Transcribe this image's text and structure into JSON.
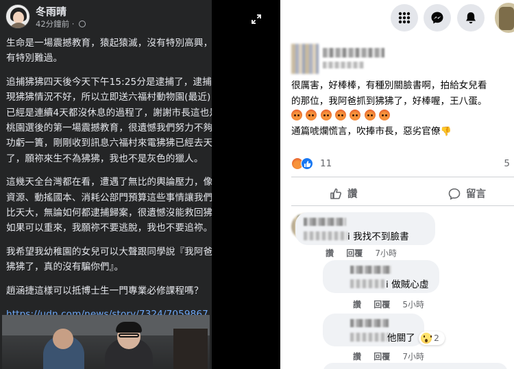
{
  "left_post": {
    "author": "冬雨晴",
    "time": "42分鐘前",
    "paragraphs": [
      [
        "生命是一場震撼教育，猿起猿滅，沒有特別高興，也沒",
        "有特別難過。"
      ],
      [
        "追捕狒狒四天後今天下午15:25分是逮捕了，逮捕後發",
        "現狒狒情況不好，所以立即送六福村動物園(最近)，這",
        "已經是連續4天都沒休息的過程了，謝謝市長這也是來",
        "桃園選後的第一場震撼教育，很遺憾我們努力不夠終究",
        "功虧一簣，剛剛收到訊息六福村來電狒狒已經去天堂",
        "了，願祢來生不為狒狒，我也不是灰色的獵人。"
      ],
      [
        "這幾天全台灣都在看，遭遇了無比的輿論壓力，像無限",
        "資源、動搖國本、消耗公部門預算這些事情讓我們壓力",
        "比天大，無論如何都逮捕歸案，很遺憾沒能救回狒狒！",
        "如果可以重來，我願祢不要逃脫，我也不要追祢。"
      ],
      [
        "我希望我幼稚園的女兒可以大聲跟同學說『我阿爸抓到",
        "狒狒了，真的沒有騙你們』。"
      ],
      [
        "趙涵捷這樣可以抵博士生一門專業必修課程嗎？"
      ]
    ],
    "link": "https://udn.com/news/story/7324/7059867"
  },
  "right_post": {
    "comment_lines": [
      "很厲害，好棒棒，有種別關臉書啊，拍給女兒看",
      "的那位，我阿爸抓到狒狒了，好棒喔，王八蛋。",
      "通篇唬爛慌言，吹捧市長，惡劣官僚"
    ],
    "reaction_count": "11",
    "shares_partial": "5",
    "like_label": "讚",
    "comment_label": "留言"
  },
  "comments": [
    {
      "text": "i 我找不到臉書",
      "like": "讚",
      "reply": "回覆",
      "time": "7小時"
    },
    {
      "text": "i 做賊心虛",
      "like": "讚",
      "reply": "回覆",
      "time": "5小時"
    },
    {
      "text": "他關了",
      "like": "讚",
      "reply": "回覆",
      "time": "7小時",
      "wow_count": "2"
    }
  ],
  "colors": {
    "dark_bg": "#242526",
    "link_blue": "#6ea8f7",
    "fb_blue": "#1877f2",
    "bubble_gray": "#f0f2f5",
    "meta_gray": "#65676b"
  },
  "icons": {
    "top_bar": [
      "menu-grid-icon",
      "messenger-icon",
      "bell-icon"
    ],
    "expand": "expand-icon",
    "reactions": [
      "angry-reaction-icon",
      "like-reaction-icon",
      "wow-reaction-icon"
    ]
  }
}
